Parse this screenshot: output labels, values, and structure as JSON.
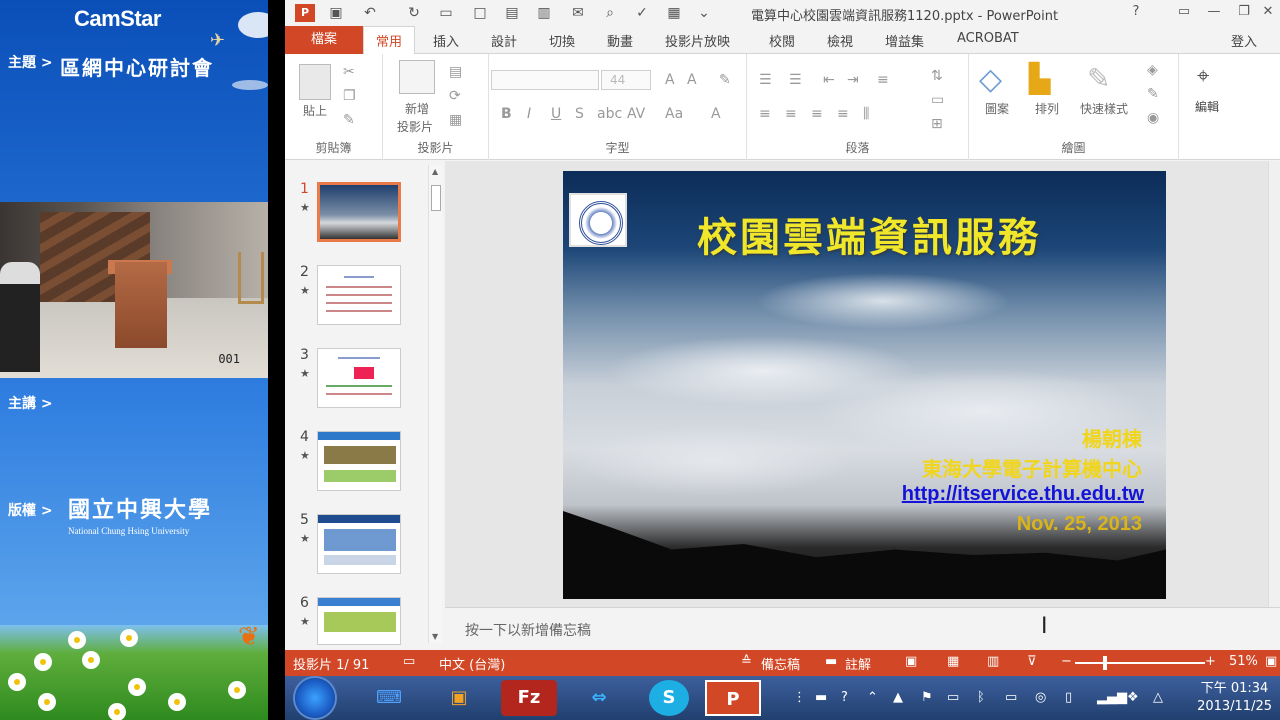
{
  "left_panel": {
    "logo": "CamStar",
    "topic_label": "主題 >",
    "topic": "區網中心研討會",
    "speaker_label": "主講 >",
    "copyright_label": "版權 >",
    "university_zh": "國立中興大學",
    "university_en": "National Chung Hsing University",
    "video_counter": "001"
  },
  "window": {
    "title": "電算中心校園雲端資訊服務1120.pptx - PowerPoint",
    "app_icon": "P"
  },
  "tabs": [
    "檔案",
    "常用",
    "插入",
    "設計",
    "切換",
    "動畫",
    "投影片放映",
    "校閱",
    "檢視",
    "增益集",
    "ACROBAT"
  ],
  "active_tab": "常用",
  "login": "登入",
  "ribbon": {
    "clipboard": {
      "paste": "貼上",
      "group": "剪貼簿"
    },
    "slides": {
      "new_slide_line1": "新增",
      "new_slide_line2": "投影片",
      "group": "投影片"
    },
    "font": {
      "size": "44",
      "group": "字型"
    },
    "paragraph": {
      "group": "段落"
    },
    "drawing": {
      "shapes": "圖案",
      "arrange": "排列",
      "quick_styles": "快速樣式",
      "group": "繪圖"
    },
    "editing": {
      "label": "編輯"
    }
  },
  "thumbnails": [
    {
      "num": "1",
      "star": "★"
    },
    {
      "num": "2",
      "star": "★"
    },
    {
      "num": "3",
      "star": "★"
    },
    {
      "num": "4",
      "star": "★"
    },
    {
      "num": "5",
      "star": "★"
    },
    {
      "num": "6",
      "star": "★"
    }
  ],
  "slide": {
    "title": "校園雲端資訊服務",
    "author": "楊朝棟",
    "org": "東海大學電子計算機中心",
    "url": "http://itservice.thu.edu.tw",
    "date": "Nov. 25, 2013"
  },
  "notes_placeholder": "按一下以新增備忘稿",
  "status": {
    "slide_counter": "投影片 1/ 91",
    "language": "中文 (台灣)",
    "notes_btn": "備忘稿",
    "comments_btn": "註解",
    "zoom": "51%"
  },
  "taskbar": {
    "clock_time": "下午 01:34",
    "clock_date": "2013/11/25"
  },
  "colors": {
    "accent": "#d24726",
    "slide_title": "#f0e62a",
    "slide_link": "#1414d8"
  }
}
